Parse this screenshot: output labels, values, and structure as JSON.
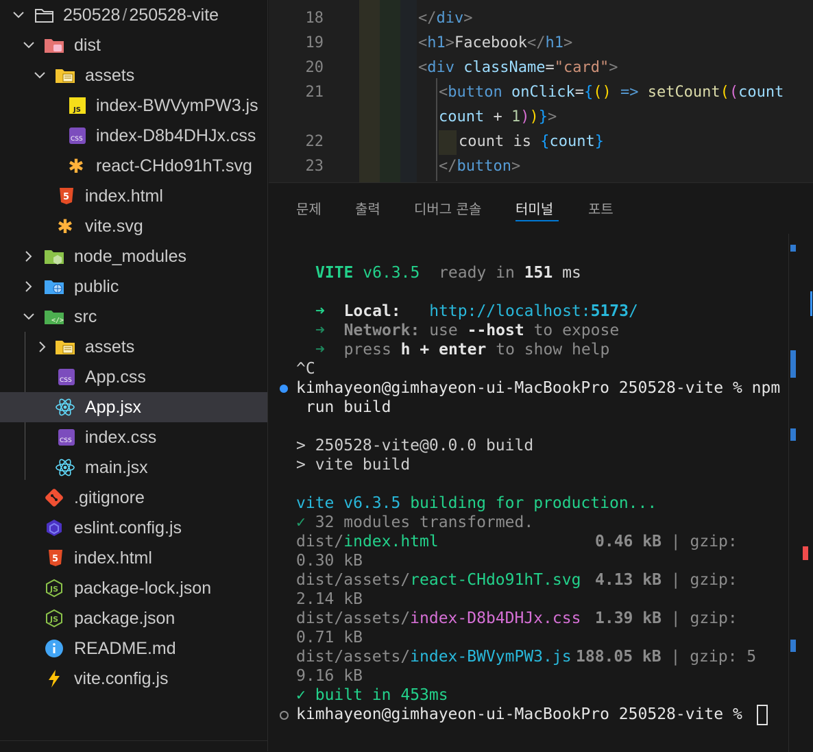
{
  "explorer": {
    "root": {
      "label_a": "250528",
      "sep": "/",
      "label_b": "250528-vite"
    },
    "items": [
      {
        "label": "dist"
      },
      {
        "label": "assets"
      },
      {
        "label": "index-BWVymPW3.js"
      },
      {
        "label": "index-D8b4DHJx.css"
      },
      {
        "label": "react-CHdo91hT.svg"
      },
      {
        "label": "index.html"
      },
      {
        "label": "vite.svg"
      },
      {
        "label": "node_modules"
      },
      {
        "label": "public"
      },
      {
        "label": "src"
      },
      {
        "label": "assets"
      },
      {
        "label": "App.css"
      },
      {
        "label": "App.jsx"
      },
      {
        "label": "index.css"
      },
      {
        "label": "main.jsx"
      },
      {
        "label": ".gitignore"
      },
      {
        "label": "eslint.config.js"
      },
      {
        "label": "index.html"
      },
      {
        "label": "package-lock.json"
      },
      {
        "label": "package.json"
      },
      {
        "label": "README.md"
      },
      {
        "label": "vite.config.js"
      }
    ]
  },
  "editor": {
    "line_numbers": [
      "18",
      "19",
      "20",
      "21",
      "22",
      "23"
    ],
    "code": {
      "l18": {
        "open": "</",
        "tag": "div",
        "close": ">"
      },
      "l19": {
        "o1": "<",
        "tag": "h1",
        "c1": ">",
        "text": "Facebook",
        "o2": "</",
        "tag2": "h1",
        "c2": ">"
      },
      "l20": {
        "o": "<",
        "tag": "div",
        "attr": "className",
        "eq": "=",
        "val": "\"card\"",
        "c": ">"
      },
      "l21a": {
        "o": "<",
        "tag": "button",
        "attr": "onClick",
        "eq": "=",
        "b1": "{",
        "p1": "(",
        "p2": ")",
        "arrow": "=>",
        "fn": "setCount",
        "p3": "(",
        "p4": "(",
        "var": "count"
      },
      "l21b": {
        "var": "count",
        "op": " + ",
        "num": "1",
        "p5": ")",
        "p6": ")",
        "b2": "}",
        "c": ">"
      },
      "l22": {
        "text": "count is ",
        "b1": "{",
        "var": "count",
        "b2": "}"
      },
      "l23": {
        "open": "</",
        "tag": "button",
        "close": ">"
      }
    }
  },
  "panel": {
    "tabs": [
      "문제",
      "출력",
      "디버그 콘솔",
      "터미널",
      "포트"
    ],
    "active_tab": "터미널"
  },
  "terminal": {
    "vite_ready": {
      "name": "VITE",
      "version": "v6.3.5",
      "ready": "ready in",
      "time": "151",
      "unit": "ms"
    },
    "local": {
      "arrow": "➜",
      "label": "Local:",
      "url_a": "http://localhost:",
      "port": "5173",
      "url_b": "/"
    },
    "network": {
      "arrow": "➜",
      "label": "Network:",
      "pre": "use",
      "flag": "--host",
      "post": "to expose"
    },
    "help": {
      "arrow": "➜",
      "pre": "press",
      "key1": "h",
      "plus": "+",
      "key2": "enter",
      "post": "to show help"
    },
    "ctrl_c": "^C",
    "prompt1": "kimhayeon@gimhayeon-ui-MacBookPro 250528-vite % npm",
    "prompt1_wrap": " run build",
    "script1": "> 250528-vite@0.0.0 build",
    "script2": "> vite build",
    "building": {
      "a": "vite v6.3.5",
      "b": "building for production..."
    },
    "transformed": {
      "check": "✓",
      "text": "32 modules transformed."
    },
    "outputs": [
      {
        "dir": "dist/",
        "file": "index.html",
        "size": "0.46 kB",
        "gzip_a": "gzip:",
        "gzip_b": "0.30 kB"
      },
      {
        "dir": "dist/assets/",
        "file": "react-CHdo91hT.svg",
        "size": "4.13 kB",
        "gzip_a": "gzip:",
        "gzip_b": "2.14 kB"
      },
      {
        "dir": "dist/assets/",
        "file": "index-D8b4DHJx.css",
        "size": "1.39 kB",
        "gzip_a": "gzip:",
        "gzip_b": "0.71 kB"
      },
      {
        "dir": "dist/assets/",
        "file": "index-BWVymPW3.js",
        "size": "188.05 kB",
        "gzip_a": "gzip: 5",
        "gzip_b": "9.16 kB"
      }
    ],
    "built": {
      "check": "✓",
      "text": "built in 453ms"
    },
    "prompt2": "kimhayeon@gimhayeon-ui-MacBookPro 250528-vite %"
  },
  "colors": {
    "accent": "#0078d4",
    "selected_row": "#37373d",
    "terminal_green": "#23d18b"
  }
}
